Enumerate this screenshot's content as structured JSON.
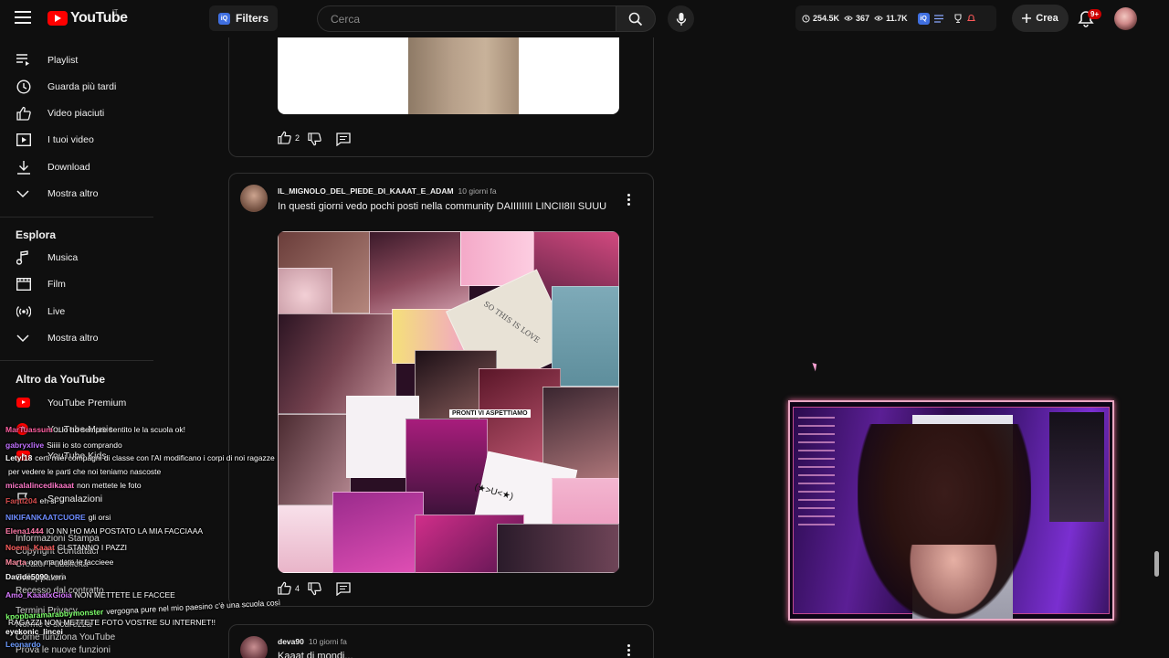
{
  "header": {
    "logo_text": "YouTube",
    "logo_country": "IT",
    "filters_label": "Filters",
    "iq_badge": "iQ",
    "search_placeholder": "Cerca",
    "stats": {
      "watch_time": "254.5K",
      "views": "367",
      "views_total": "11.7K"
    },
    "create_label": "Crea",
    "notif_badge": "9+"
  },
  "sidebar": {
    "items_top": [
      {
        "label": "Playlist",
        "icon": "playlist-icon"
      },
      {
        "label": "Guarda più tardi",
        "icon": "clock-icon"
      },
      {
        "label": "Video piaciuti",
        "icon": "thumb-up-icon"
      },
      {
        "label": "I tuoi video",
        "icon": "play-square-icon"
      },
      {
        "label": "Download",
        "icon": "download-icon"
      },
      {
        "label": "Mostra altro",
        "icon": "chevron-down-icon"
      }
    ],
    "explore_heading": "Esplora",
    "explore_items": [
      {
        "label": "Musica",
        "icon": "music-note-icon"
      },
      {
        "label": "Film",
        "icon": "film-icon"
      },
      {
        "label": "Live",
        "icon": "live-icon"
      },
      {
        "label": "Mostra altro",
        "icon": "chevron-down-icon"
      }
    ],
    "more_heading": "Altro da YouTube",
    "more_items": [
      {
        "label": "YouTube Premium"
      },
      {
        "label": "YouTube Music"
      },
      {
        "label": "YouTube Kids"
      }
    ],
    "report_label": "Segnalazioni",
    "footer": [
      "Informazioni  Stampa",
      "Copyright  Contattaci",
      "Creator  Pubblicità",
      "Sviluppatori",
      "Recesso dal contratto",
      "Termini  Privacy",
      "Norme e sicurezza",
      "Come funziona YouTube",
      "Prova le nuove funzioni"
    ]
  },
  "chat": [
    {
      "user": "MarTuassum",
      "msg": "...io ho sempre sentito le la scuola ok!",
      "color": "#ff5fa0"
    },
    {
      "user": "gabryxlive",
      "msg": "Siiiii io sto comprando",
      "color": "#c070ff"
    },
    {
      "user": "Letyl18",
      "msg": "certi miei compagni di classe con l'AI modificano i corpi di noi ragazze",
      "color": "#ffffff"
    },
    {
      "user": "",
      "msg": "per vedere le parti che noi teniamo nascoste",
      "color": "#ffffff"
    },
    {
      "user": "micalalincedikaaat",
      "msg": "non mettete le foto",
      "color": "#ff78c8"
    },
    {
      "user": "Fanti204",
      "msg": "eh si",
      "color": "#d24b4b"
    },
    {
      "user": "NIKIFANKAATCUORE",
      "msg": "gli orsi",
      "color": "#6d8cff"
    },
    {
      "user": "Elena1444",
      "msg": "IO NN HO MAI POSTATO LA MIA FACCIAAA",
      "color": "#ff7aa8"
    },
    {
      "user": "Noemi_Kaaat",
      "msg": "CI STANNO I PAZZI",
      "color": "#ff5f5f"
    },
    {
      "user": "Marta",
      "msg": "non mandate le faccieee",
      "color": "#ff8aa0"
    },
    {
      "user": "Davide5090",
      "msg": "vera",
      "color": "#ffffff"
    },
    {
      "user": "Amo_KaaatxGioia",
      "msg": "NON METTETE LE FACCEE",
      "color": "#d87aff"
    },
    {
      "user": "kpopbaramarabbymonster",
      "msg": "vergogna pure nel mio paesino c'è una scuola così",
      "color": "#7dff6b"
    },
    {
      "user": "",
      "msg": "RAGAZZI NON METTETE FOTO VOSTRE SU INTERNET!!",
      "color": "#ffffff"
    },
    {
      "user": "eyekonic_lincei",
      "msg": "",
      "color": "#ffffff"
    },
    {
      "user": "Leonardo",
      "msg": "",
      "color": "#6d9cff"
    }
  ],
  "posts": [
    {
      "likes": "2"
    },
    {
      "author": "IL_MIGNOLO_DEL_PIEDE_DI_KAAAT_E_ADAM",
      "time": "10 giorni fa",
      "text": "In questi giorni vedo pochi posti nella community DAIIIIIIII LINCII8II SUUU",
      "likes": "4",
      "collage_text": [
        "PRONTI VI ASPETTIAMO",
        "SO THIS IS LOVE",
        "(★>U<★)"
      ]
    },
    {
      "author": "deva90",
      "time": "10 giorni fa",
      "text": "Kaaat di mondi..."
    }
  ],
  "colors": {
    "accent": "#ff0000",
    "cam_border": "#e9a7c2"
  }
}
